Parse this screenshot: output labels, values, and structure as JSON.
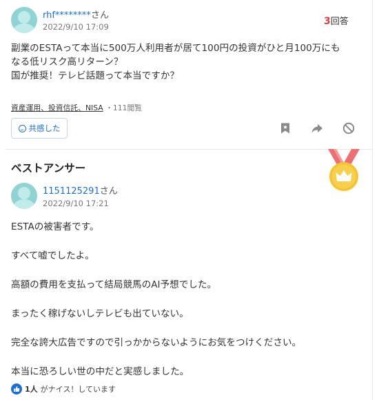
{
  "question": {
    "user_name": "rhf********",
    "honorific": "さん",
    "date": "2022/9/10 17:09",
    "answer_count": "3",
    "answer_label": "回答",
    "body_lines": [
      "副業のESTAって本当に500万人利用者が居て100円の投資がひと月100万にも",
      "なる低リスク高リターン？",
      "国が推奨！テレビ話題って本当ですか？"
    ],
    "category": "資産運用、投資信託、NISA",
    "views": "111閲覧",
    "empathy_label": "共感した",
    "icons": [
      "bookmark-icon",
      "share-icon",
      "report-icon"
    ]
  },
  "best_answer": {
    "section_title": "ベストアンサー",
    "user_name": "1151125291",
    "honorific": "さん",
    "date": "2022/9/10 17:21",
    "paragraphs": [
      "ESTAの被害者です。",
      "すべて嘘でしたよ。",
      "高額の費用を支払って結局競馬のAI予想でした。",
      "まったく稼げないしテレビも出ていない。",
      "完全な誇大広告ですので引っかからないようにお気をつけください。",
      "本当に恐ろしい世の中だと実感しました。"
    ],
    "nice_count": "1人",
    "nice_text": "がナイス！しています"
  },
  "colors": {
    "link": "#1a6fd6",
    "answer_count": "#e63b3b",
    "medal_gold": "#f5c330",
    "medal_ribbon": "#ef6e73",
    "avatar": "#8fd3d2"
  }
}
